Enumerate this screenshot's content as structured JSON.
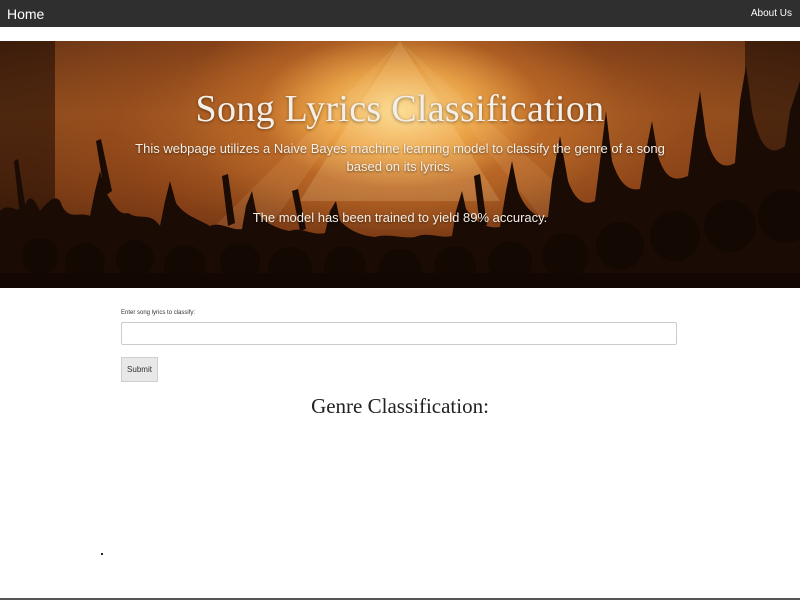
{
  "nav": {
    "home_label": "Home",
    "about_label": "About Us"
  },
  "hero": {
    "title": "Song Lyrics Classification",
    "description": "This webpage utilizes a Naive Bayes machine learning model to classify the genre of a song based on its lyrics.",
    "accuracy_note": "The model has been trained to yield 89% accuracy."
  },
  "form": {
    "label": "Enter song lyrics to classify:",
    "input_value": "",
    "input_placeholder": "",
    "submit_label": "Submit"
  },
  "result": {
    "heading": "Genre Classification:"
  },
  "colors": {
    "navbar_bg": "#2f2f2f",
    "hero_accent": "#d68432"
  }
}
